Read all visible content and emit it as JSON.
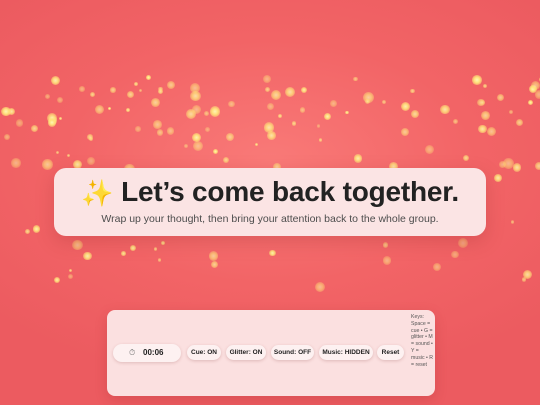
{
  "banner": {
    "icon": "sparkles-icon",
    "icon_glyph": "✨",
    "title": "Let’s come back together.",
    "subtitle": "Wrap up your thought, then bring your attention back to the whole group."
  },
  "controls": {
    "timer_icon": "stopwatch-icon",
    "timer_glyph": "⏱",
    "timer_value": "00:06",
    "cue_label": "Cue: ON",
    "glitter_label": "Glitter: ON",
    "sound_label": "Sound: OFF",
    "music_label": "Music: HIDDEN",
    "reset_label": "Reset",
    "keys_help": "Keys: Space = cue • G = glitter • M = sound • Y = music • R = reset"
  },
  "colors": {
    "background": "#f26466",
    "card": "#fbe4e4",
    "sparkle": "#ffe27a",
    "text": "#222222"
  }
}
